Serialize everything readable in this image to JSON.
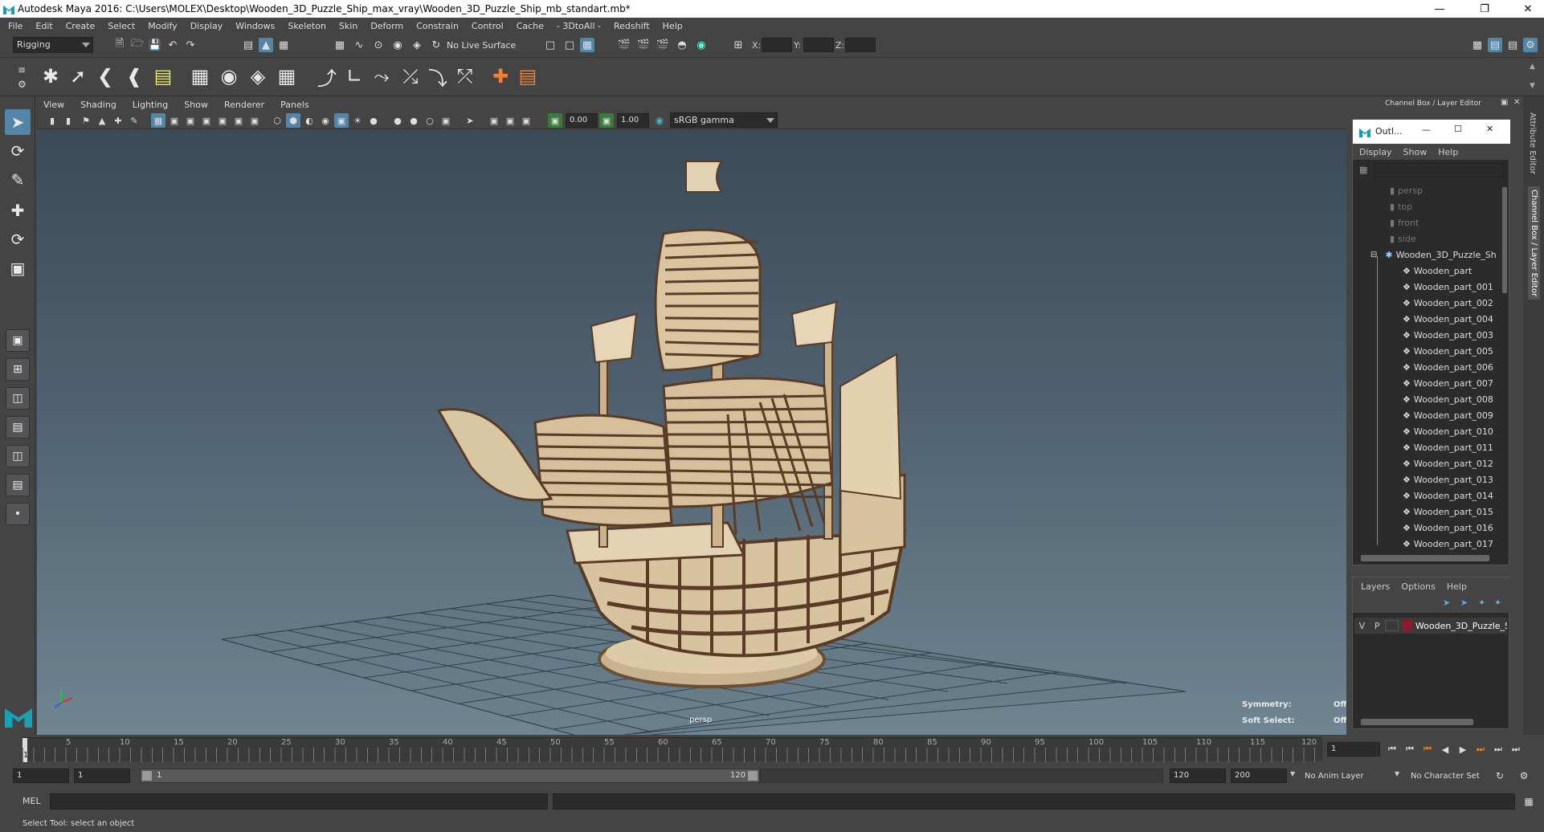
{
  "window": {
    "title": "Autodesk Maya 2016: C:\\Users\\MOLEX\\Desktop\\Wooden_3D_Puzzle_Ship_max_vray\\Wooden_3D_Puzzle_Ship_mb_standart.mb*"
  },
  "menu": [
    "File",
    "Edit",
    "Create",
    "Select",
    "Modify",
    "Display",
    "Windows",
    "Skeleton",
    "Skin",
    "Deform",
    "Constrain",
    "Control",
    "Cache",
    "- 3DtoAll -",
    "Redshift",
    "Help"
  ],
  "status": {
    "mode": "Rigging",
    "live_surface": "No Live Surface",
    "x_label": "X:",
    "y_label": "Y:",
    "z_label": "Z:"
  },
  "viewport": {
    "menu": [
      "View",
      "Shading",
      "Lighting",
      "Show",
      "Renderer",
      "Panels"
    ],
    "exposure": "0.00",
    "gamma": "1.00",
    "colorspace": "sRGB gamma",
    "camera": "persp",
    "symmetry_label": "Symmetry:",
    "symmetry_value": "Off",
    "soft_select_label": "Soft Select:",
    "soft_select_value": "Off"
  },
  "right_panel": {
    "header": "Channel Box / Layer Editor",
    "tab_attr": "Attribute Editor",
    "tab_channel": "Channel Box / Layer Editor"
  },
  "outliner": {
    "title": "Outl...",
    "menu": [
      "Display",
      "Show",
      "Help"
    ],
    "cameras": [
      "persp",
      "top",
      "front",
      "side"
    ],
    "group": "Wooden_3D_Puzzle_Sh",
    "items": [
      "Wooden_part",
      "Wooden_part_001",
      "Wooden_part_002",
      "Wooden_part_004",
      "Wooden_part_003",
      "Wooden_part_005",
      "Wooden_part_006",
      "Wooden_part_007",
      "Wooden_part_008",
      "Wooden_part_009",
      "Wooden_part_010",
      "Wooden_part_011",
      "Wooden_part_012",
      "Wooden_part_013",
      "Wooden_part_014",
      "Wooden_part_015",
      "Wooden_part_016",
      "Wooden_part_017"
    ]
  },
  "layers": {
    "menu": [
      "Layers",
      "Options",
      "Help"
    ],
    "v": "V",
    "p": "P",
    "layer_name": "Wooden_3D_Puzzle_Sl",
    "layer_color": "#8b1a2b"
  },
  "timeline": {
    "ticks": [
      "5",
      "10",
      "15",
      "20",
      "25",
      "30",
      "35",
      "40",
      "45",
      "50",
      "55",
      "60",
      "65",
      "70",
      "75",
      "80",
      "85",
      "90",
      "95",
      "100",
      "105",
      "110",
      "115",
      "120"
    ],
    "current_left": "1",
    "current_field": "1"
  },
  "range": {
    "start": "1",
    "start2": "1",
    "slider_start": "1",
    "slider_end": "120",
    "end": "120",
    "end2": "200",
    "anim_layer": "No Anim Layer",
    "character_set": "No Character Set"
  },
  "cmd": {
    "label": "MEL"
  },
  "help": {
    "text": "Select Tool: select an object"
  }
}
